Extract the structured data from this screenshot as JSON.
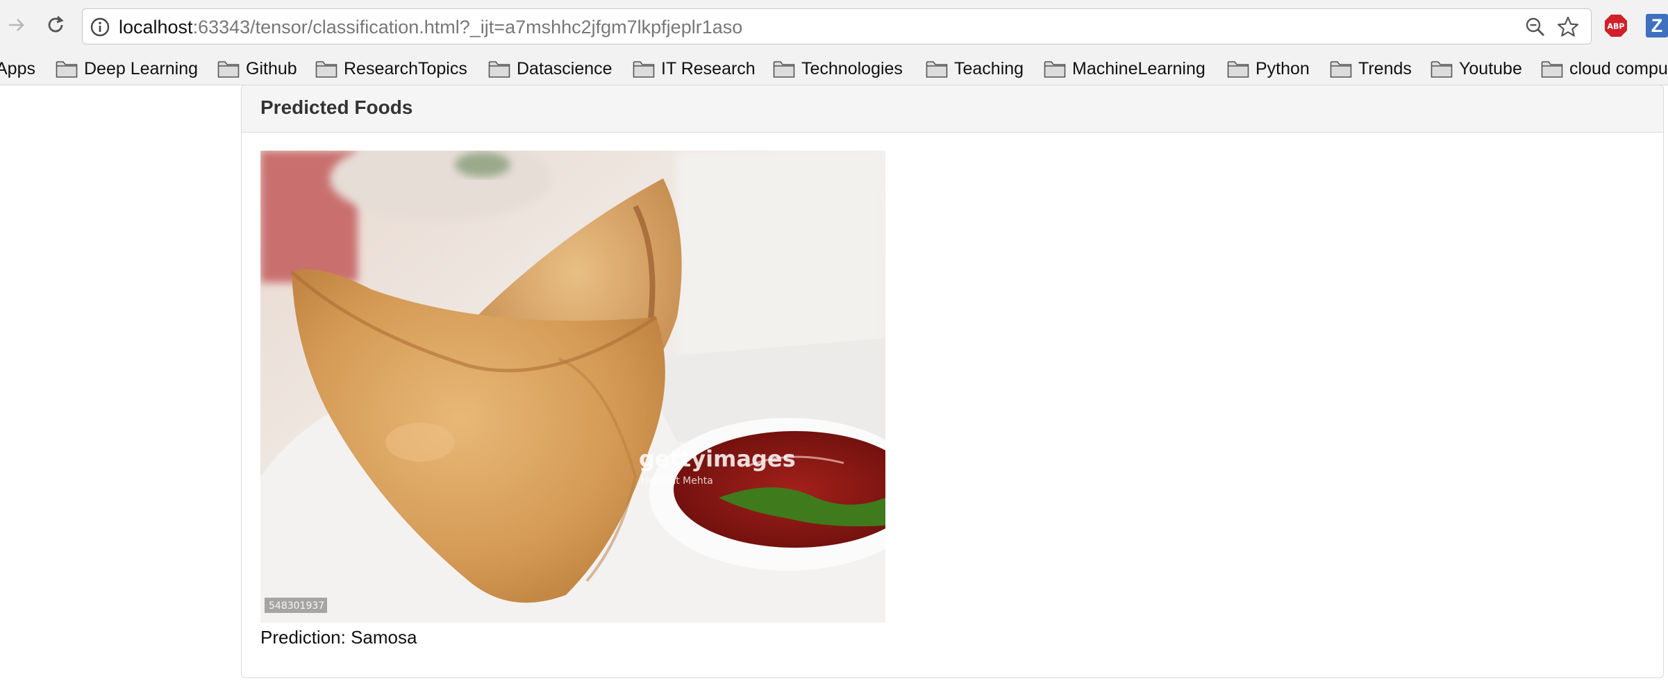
{
  "browser": {
    "url_host": "localhost",
    "url_rest": ":63343/tensor/classification.html?_ijt=a7mshhc2jfgm7lkpfjeplr1aso",
    "extension_abp_label": "ABP",
    "extension_z_label": "Z"
  },
  "bookmarks": [
    {
      "label": "Apps"
    },
    {
      "label": "Deep Learning"
    },
    {
      "label": "Github"
    },
    {
      "label": "ResearchTopics"
    },
    {
      "label": "Datascience"
    },
    {
      "label": "IT Research"
    },
    {
      "label": "Technologies"
    },
    {
      "label": "Teaching"
    },
    {
      "label": "MachineLearning"
    },
    {
      "label": "Python"
    },
    {
      "label": "Trends"
    },
    {
      "label": "Youtube"
    },
    {
      "label": "cloud compu"
    }
  ],
  "panel": {
    "title": "Predicted Foods",
    "prediction_text": "Prediction: Samosa",
    "image": {
      "watermark_brand": "gettyimages",
      "watermark_credit": "Hemant Mehta",
      "image_id": "548301937"
    }
  },
  "colors": {
    "abp_red": "#d0202a",
    "z_blue": "#3f6fbf"
  }
}
